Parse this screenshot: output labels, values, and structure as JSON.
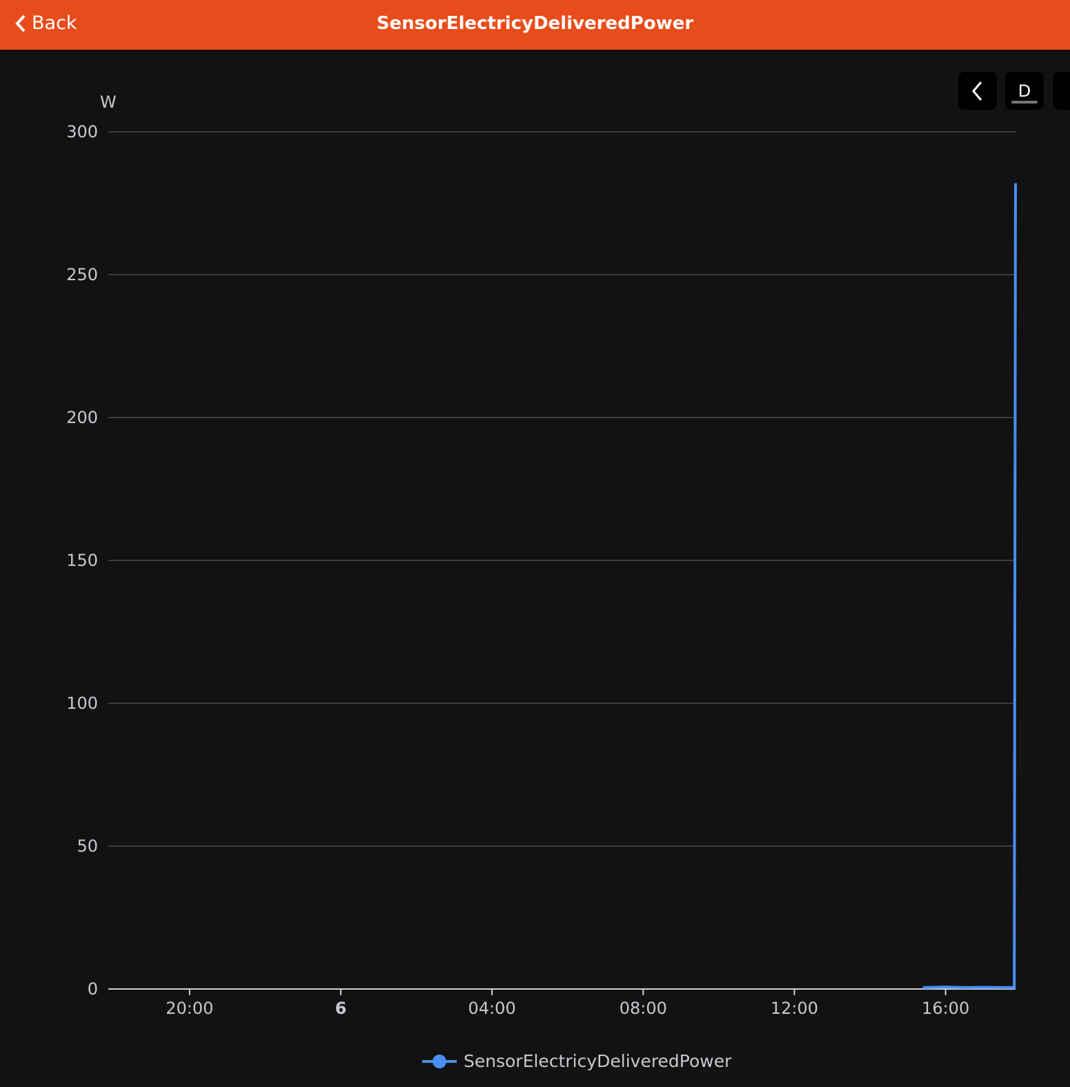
{
  "header": {
    "back_label": "Back",
    "title": "SensorElectricyDeliveredPower"
  },
  "toolbar": {
    "prev_icon": "chevron-left-icon",
    "period_label": "D"
  },
  "colors": {
    "header": "#e84c1b",
    "series": "#4a8ef5",
    "background": "#121212"
  },
  "chart_data": {
    "type": "line",
    "title": "",
    "ylabel": "W",
    "ylim": [
      0,
      300
    ],
    "yticks": [
      "0",
      "50",
      "100",
      "150",
      "200",
      "250",
      "300"
    ],
    "xlim": [
      "05 17:51",
      "06 17:51"
    ],
    "xticks": [
      {
        "x": "05 20:00",
        "label": "20:00"
      },
      {
        "x": "06 00:00",
        "label": "6"
      },
      {
        "x": "06 04:00",
        "label": "04:00"
      },
      {
        "x": "06 08:00",
        "label": "08:00"
      },
      {
        "x": "06 12:00",
        "label": "12:00"
      },
      {
        "x": "06 16:00",
        "label": "16:00"
      }
    ],
    "grid": true,
    "legend": "bottom",
    "series": [
      {
        "name": "SensorElectricyDeliveredPower",
        "x": [
          "06 15:24",
          "06 15:45",
          "06 16:00",
          "06 16:30",
          "06 17:00",
          "06 17:30",
          "06 17:49",
          "06 17:51"
        ],
        "values": [
          0.5,
          0.6,
          0.7,
          0.5,
          0.6,
          0.5,
          0.5,
          282
        ]
      }
    ]
  }
}
